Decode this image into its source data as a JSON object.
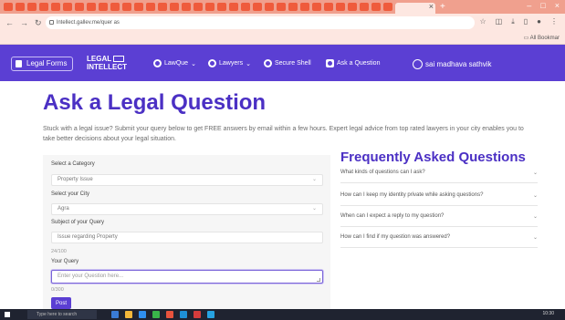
{
  "browser": {
    "tab_colors": [
      "#ef5b3c",
      "#ef5b3c",
      "#ef5b3c",
      "#ef5b3c",
      "#ef5b3c",
      "#ef5b3c",
      "#ef5b3c",
      "#ef5b3c",
      "#ef5b3c",
      "#ef5b3c",
      "#ef5b3c",
      "#ef5b3c",
      "#ef5b3c",
      "#ef5b3c",
      "#ef5b3c",
      "#ef5b3c",
      "#ef5b3c",
      "#ef5b3c",
      "#ef5b3c",
      "#ef5b3c",
      "#ef5b3c",
      "#ef5b3c",
      "#ef5b3c",
      "#ef5b3c",
      "#ef5b3c",
      "#ef5b3c",
      "#ef5b3c",
      "#ef5b3c",
      "#ef5b3c",
      "#ef5b3c",
      "#ef5b3c",
      "#ef5b3c",
      "#ef5b3c",
      "#ef5b3c"
    ],
    "url": "lntellect.gallev.me/quer as",
    "bookmarks_label": "All Bookmar"
  },
  "navbar": {
    "legal_forms": "Legal Forms",
    "logo_line1": "LEGAL",
    "logo_line2": "INTELLECT",
    "lawque": "LawQue",
    "lawyers": "Lawyers",
    "secure_shell": "Secure Shell",
    "ask_question": "Ask a Question",
    "user_name": "sai madhava sathvik",
    "brand_color": "#5b3fd3"
  },
  "main": {
    "title": "Ask a Legal Question",
    "intro": "Stuck with a legal issue? Submit your query below to get FREE answers by email within a few hours. Expert legal advice from top rated lawyers in your city enables you to take better decisions about your legal situation."
  },
  "form": {
    "category_label": "Select a Category",
    "category_value": "Property Issue",
    "city_label": "Select your City",
    "city_value": "Agra",
    "subject_label": "Subject of your Query",
    "subject_value": "Issue regarding Property",
    "subject_counter": "24/100",
    "query_label": "Your Query",
    "query_placeholder": "Enter your Question here...",
    "query_counter": "0/300",
    "post_label": "Post"
  },
  "faq": {
    "title": "Frequently Asked Questions",
    "items": [
      "What kinds of questions can I ask?",
      "How can I keep my identity private while asking questions?",
      "When can I expect a reply to my question?",
      "How can I find if my question was answered?"
    ]
  },
  "taskbar": {
    "search_placeholder": "Type here to search",
    "clock": "10:30"
  }
}
